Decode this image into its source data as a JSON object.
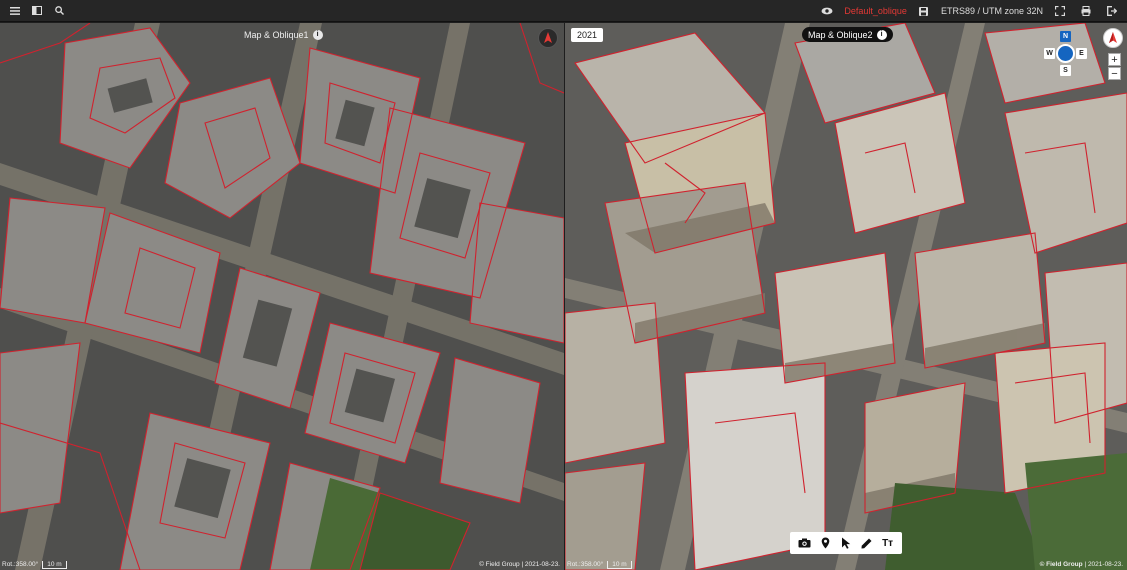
{
  "toolbar": {
    "menu_icon": "hamburger-icon",
    "panel_icon": "panel-toggle-icon",
    "search_icon": "search-icon",
    "visibility_icon": "eye-icon",
    "layer_name": "Default_oblique",
    "save_icon": "save-icon",
    "crs": "ETRS89 / UTM zone 32N",
    "fullscreen_icon": "fullscreen-icon",
    "print_icon": "print-icon",
    "exit_icon": "exit-icon",
    "layer_color": "#e53935"
  },
  "left_view": {
    "label": "Map & Oblique1",
    "info": "i",
    "rotation": "Rot.:358.00°",
    "scale": "10 m",
    "copyright": "© Field Group | 2021-08-23."
  },
  "right_view": {
    "year": "2021",
    "label": "Map & Oblique2",
    "info": "i",
    "nav": {
      "n": "N",
      "w": "W",
      "e": "E",
      "s": "S"
    },
    "zoom_in": "+",
    "zoom_out": "−",
    "rotation": "Rot.:358.00°",
    "scale": "10 m",
    "copyright_owner": "© Field Group",
    "copyright_date": " | 2021-08-23.",
    "tools": {
      "camera": "camera-icon",
      "pin": "location-pin-icon",
      "pointer": "pointer-icon",
      "pen": "pen-icon",
      "text": "Tт"
    }
  },
  "colors": {
    "parcel_line": "#d0222e",
    "accent": "#1565c0"
  }
}
